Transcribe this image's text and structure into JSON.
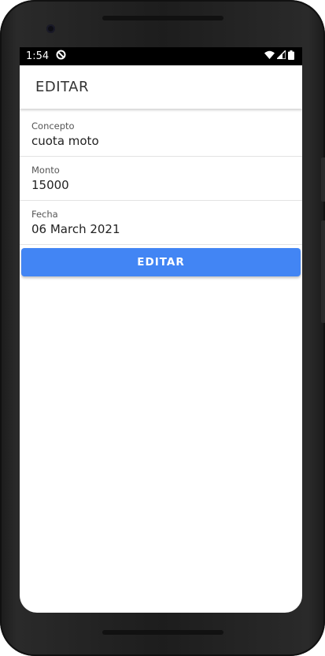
{
  "status_bar": {
    "time": "1:54",
    "icons": [
      "notification-icon",
      "wifi-icon",
      "signal-icon",
      "battery-icon"
    ]
  },
  "app_bar": {
    "title": "EDITAR"
  },
  "form": {
    "fields": [
      {
        "label": "Concepto",
        "value": "cuota moto"
      },
      {
        "label": "Monto",
        "value": "15000"
      },
      {
        "label": "Fecha",
        "value": "06 March 2021"
      }
    ],
    "submit_label": "EDITAR"
  },
  "colors": {
    "accent": "#4285f4",
    "frame": "#1e1e1e"
  }
}
